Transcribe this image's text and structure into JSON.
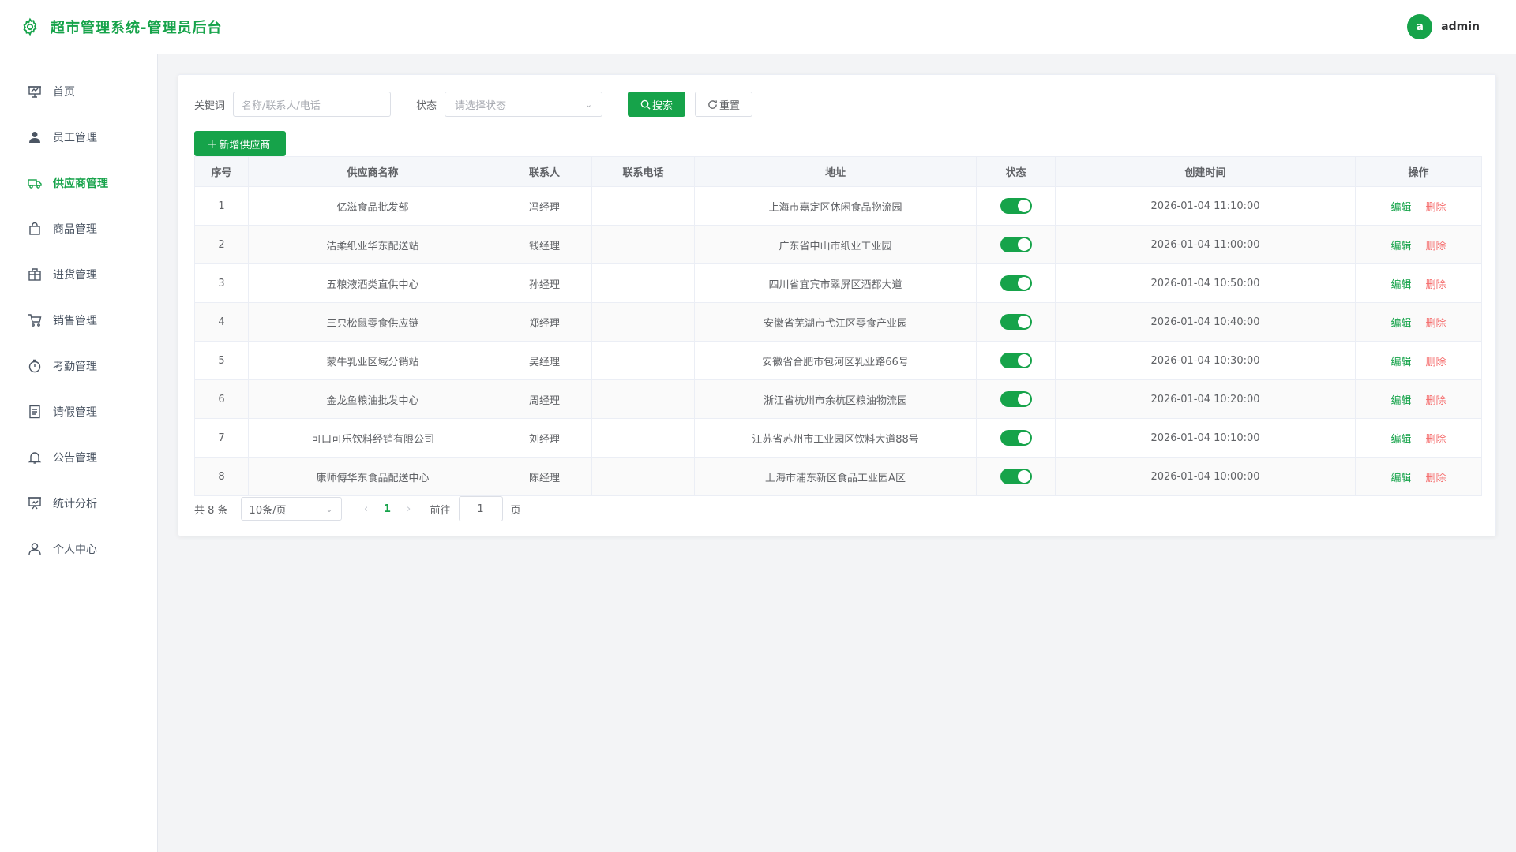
{
  "header": {
    "title": "超市管理系统-管理员后台",
    "avatar_letter": "a",
    "username": "admin"
  },
  "sidebar": {
    "items": [
      {
        "label": "首页",
        "icon": "presentation-icon"
      },
      {
        "label": "员工管理",
        "icon": "user-icon"
      },
      {
        "label": "供应商管理",
        "icon": "truck-icon"
      },
      {
        "label": "商品管理",
        "icon": "shopping-bag-icon"
      },
      {
        "label": "进货管理",
        "icon": "box-icon"
      },
      {
        "label": "销售管理",
        "icon": "cart-icon"
      },
      {
        "label": "考勤管理",
        "icon": "stopwatch-icon"
      },
      {
        "label": "请假管理",
        "icon": "document-icon"
      },
      {
        "label": "公告管理",
        "icon": "bell-icon"
      },
      {
        "label": "统计分析",
        "icon": "data-board-icon"
      },
      {
        "label": "个人中心",
        "icon": "user-outline-icon"
      }
    ],
    "active_index": 2
  },
  "filters": {
    "keyword_label": "关键词",
    "keyword_placeholder": "名称/联系人/电话",
    "status_label": "状态",
    "status_placeholder": "请选择状态",
    "search_label": "搜索",
    "reset_label": "重置"
  },
  "add_button": "新增供应商",
  "table": {
    "columns": [
      "序号",
      "供应商名称",
      "联系人",
      "联系电话",
      "地址",
      "状态",
      "创建时间",
      "操作"
    ],
    "rows": [
      {
        "no": "1",
        "name": "亿滋食品批发部",
        "contact": "冯经理",
        "phone": "",
        "address": "上海市嘉定区休闲食品物流园",
        "enabled": true,
        "created": "2026-01-04 11:10:00"
      },
      {
        "no": "2",
        "name": "洁柔纸业华东配送站",
        "contact": "钱经理",
        "phone": "",
        "address": "广东省中山市纸业工业园",
        "enabled": true,
        "created": "2026-01-04 11:00:00"
      },
      {
        "no": "3",
        "name": "五粮液酒类直供中心",
        "contact": "孙经理",
        "phone": "",
        "address": "四川省宜宾市翠屏区酒都大道",
        "enabled": true,
        "created": "2026-01-04 10:50:00"
      },
      {
        "no": "4",
        "name": "三只松鼠零食供应链",
        "contact": "郑经理",
        "phone": "",
        "address": "安徽省芜湖市弋江区零食产业园",
        "enabled": true,
        "created": "2026-01-04 10:40:00"
      },
      {
        "no": "5",
        "name": "蒙牛乳业区域分销站",
        "contact": "吴经理",
        "phone": "",
        "address": "安徽省合肥市包河区乳业路66号",
        "enabled": true,
        "created": "2026-01-04 10:30:00"
      },
      {
        "no": "6",
        "name": "金龙鱼粮油批发中心",
        "contact": "周经理",
        "phone": "",
        "address": "浙江省杭州市余杭区粮油物流园",
        "enabled": true,
        "created": "2026-01-04 10:20:00"
      },
      {
        "no": "7",
        "name": "可口可乐饮料经销有限公司",
        "contact": "刘经理",
        "phone": "",
        "address": "江苏省苏州市工业园区饮料大道88号",
        "enabled": true,
        "created": "2026-01-04 10:10:00"
      },
      {
        "no": "8",
        "name": "康师傅华东食品配送中心",
        "contact": "陈经理",
        "phone": "",
        "address": "上海市浦东新区食品工业园A区",
        "enabled": true,
        "created": "2026-01-04 10:00:00"
      }
    ],
    "edit_label": "编辑",
    "delete_label": "删除"
  },
  "pagination": {
    "total_text": "共 8 条",
    "page_size": "10条/页",
    "current_page": "1",
    "goto_label": "前往",
    "goto_value": "1",
    "page_suffix": "页"
  },
  "colors": {
    "primary": "#16a34a",
    "danger": "#f56c6c"
  }
}
